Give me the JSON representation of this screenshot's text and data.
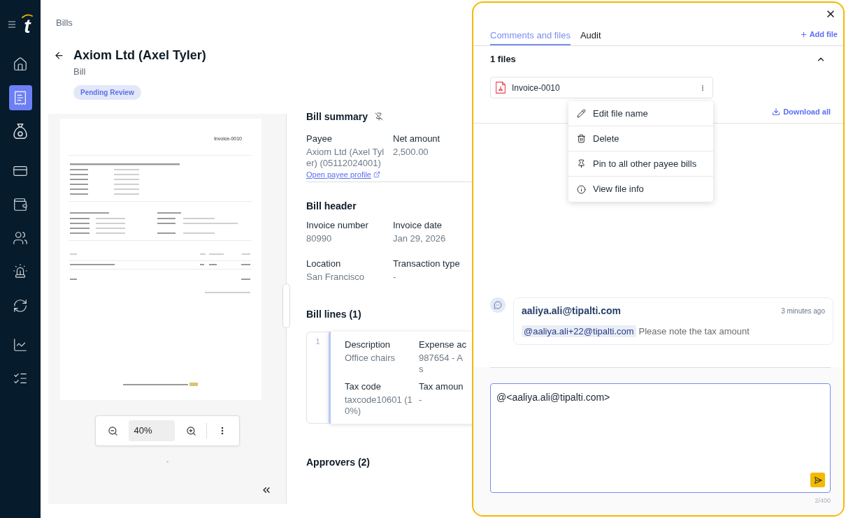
{
  "sidebar": {
    "logo": "t",
    "items": [
      {
        "selected": false
      },
      {
        "selected": true
      },
      {
        "selected": false
      },
      {
        "selected": false
      },
      {
        "selected": false
      },
      {
        "selected": false
      },
      {
        "selected": false
      },
      {
        "selected": false
      },
      {
        "selected": false
      },
      {
        "selected": false
      }
    ]
  },
  "breadcrumb": "Bills",
  "header": {
    "title": "Axiom Ltd (Axel Tyler)",
    "subtitle": "Bill",
    "status": "Pending Review"
  },
  "document_viewer": {
    "page_heading": "Invoice-0010",
    "zoom": "40%"
  },
  "bill_summary": {
    "title": "Bill summary",
    "fields": [
      {
        "label": "Payee",
        "value": "Axiom Ltd (Axel Tyler) (05112024001)",
        "link": "Open payee profile"
      },
      {
        "label": "Net amount",
        "value": "2,500.00"
      }
    ]
  },
  "bill_header": {
    "title": "Bill header",
    "fields": [
      {
        "label": "Invoice number",
        "value": "80990"
      },
      {
        "label": "Invoice date",
        "value": "Jan 29, 2026"
      },
      {
        "label": "Location",
        "value": "San Francisco"
      },
      {
        "label": "Transaction type",
        "value": "-"
      }
    ]
  },
  "bill_lines": {
    "title": "Bill lines (1)",
    "lines": [
      {
        "number": "1",
        "fields": [
          {
            "label": "Description",
            "value": "Office chairs"
          },
          {
            "label": "Expense ac",
            "value": "987654 - A\ns"
          },
          {
            "label": "Tax code",
            "value": "taxcode10601 (10%)"
          },
          {
            "label": "Tax amoun",
            "value": "-"
          }
        ]
      }
    ]
  },
  "approvers": {
    "title": "Approvers (2)"
  },
  "side_panel": {
    "tabs": [
      {
        "label": "Comments and files",
        "selected": true
      },
      {
        "label": "Audit",
        "selected": false
      }
    ],
    "add_file": "Add file",
    "files": {
      "title": "1 files",
      "expanded": true,
      "items": [
        {
          "name": "Invoice-0010"
        }
      ],
      "download_all": "Download all"
    },
    "file_menu": [
      "Edit file name",
      "Delete",
      "Pin to all other payee bills",
      "View file info"
    ],
    "comments": [
      {
        "author": "aaliya.ali@tipalti.com",
        "time": "3 minutes ago",
        "mention": "@aaliya.ali+22@tipalti.com",
        "text": "Please note the tax amount"
      }
    ],
    "composer": {
      "value": "@<aaliya.ali@tipalti.com>",
      "counter": "2/400"
    }
  }
}
